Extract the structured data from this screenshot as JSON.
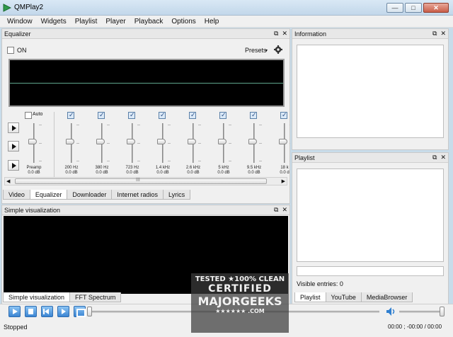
{
  "window": {
    "title": "QMPlay2",
    "icon": "qmplay-triangle-icon",
    "controls": {
      "minimize": "—",
      "maximize": "□",
      "close": "✕"
    }
  },
  "menu": [
    "Window",
    "Widgets",
    "Playlist",
    "Player",
    "Playback",
    "Options",
    "Help"
  ],
  "equalizer": {
    "title": "Equalizer",
    "on_label": "ON",
    "presets_label": "Presets",
    "auto_label": "Auto",
    "bands": [
      {
        "freq": "Preamp",
        "db": "0.0 dB",
        "checkbox": false
      },
      {
        "freq": "200 Hz",
        "db": "0.0 dB",
        "checkbox": true
      },
      {
        "freq": "380 Hz",
        "db": "0.0 dB",
        "checkbox": true
      },
      {
        "freq": "723 Hz",
        "db": "0.0 dB",
        "checkbox": true
      },
      {
        "freq": "1.4 kHz",
        "db": "0.0 dB",
        "checkbox": true
      },
      {
        "freq": "2.6 kHz",
        "db": "0.0 dB",
        "checkbox": true
      },
      {
        "freq": "5 kHz",
        "db": "0.0 dB",
        "checkbox": true
      },
      {
        "freq": "9.5 kHz",
        "db": "0.0 dB",
        "checkbox": true
      },
      {
        "freq": "18 k",
        "db": "0.0 d",
        "checkbox": true
      }
    ],
    "scroll_grip": "III"
  },
  "left_tabs": [
    "Video",
    "Equalizer",
    "Downloader",
    "Internet radios",
    "Lyrics"
  ],
  "left_tabs_active": "Equalizer",
  "visualization": {
    "title": "Simple visualization"
  },
  "vis_tabs": [
    "Simple visualization",
    "FFT Spectrum"
  ],
  "information": {
    "title": "Information"
  },
  "playlist": {
    "title": "Playlist",
    "visible_entries": "Visible entries: 0"
  },
  "right_tabs": [
    "Playlist",
    "YouTube",
    "MediaBrowser"
  ],
  "dock_controls": {
    "float": "⧉",
    "close": "✕"
  },
  "status": {
    "text": "Stopped",
    "time": "00:00 ; -00:00 / 00:00"
  },
  "watermark": {
    "line1": "TESTED ★100% CLEAN",
    "line2": "CERTIFIED",
    "line3": "MAJORGEEKS",
    "line4": "★★★★★★ .COM"
  },
  "colors": {
    "accent_blue": "#3b85d2",
    "display_black": "#000000",
    "eq_line": "#5fa58c"
  }
}
